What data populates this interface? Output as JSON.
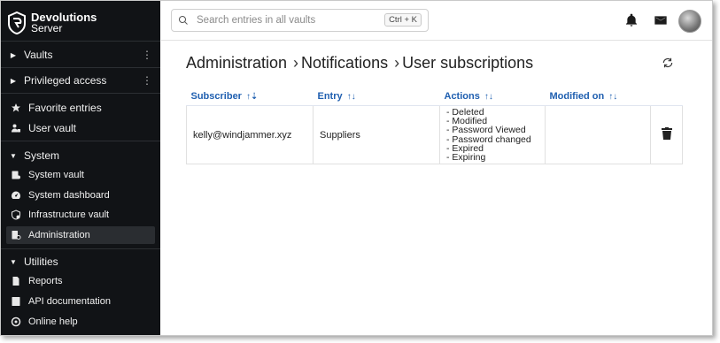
{
  "brand": {
    "name": "Devolutions",
    "product": "Server"
  },
  "sidebar": {
    "sections": [
      {
        "label": "Vaults"
      },
      {
        "label": "Privileged access"
      }
    ],
    "quick": [
      {
        "label": "Favorite entries",
        "icon": "star-icon"
      },
      {
        "label": "User vault",
        "icon": "user-vault-icon"
      }
    ],
    "system": {
      "label": "System",
      "items": [
        {
          "label": "System vault",
          "icon": "system-vault-icon"
        },
        {
          "label": "System dashboard",
          "icon": "dashboard-icon"
        },
        {
          "label": "Infrastructure vault",
          "icon": "infrastructure-vault-icon"
        },
        {
          "label": "Administration",
          "icon": "administration-icon"
        }
      ]
    },
    "utilities": {
      "label": "Utilities",
      "items": [
        {
          "label": "Reports",
          "icon": "reports-icon"
        },
        {
          "label": "API documentation",
          "icon": "api-documentation-icon"
        },
        {
          "label": "Online help",
          "icon": "help-icon"
        }
      ]
    }
  },
  "search": {
    "placeholder": "Search entries in all vaults",
    "shortcut": "Ctrl + K"
  },
  "breadcrumb": [
    "Administration",
    "Notifications",
    "User subscriptions"
  ],
  "table": {
    "columns": [
      {
        "label": "Subscriber",
        "sort": "↑⇣"
      },
      {
        "label": "Entry",
        "sort": "↑↓"
      },
      {
        "label": "Actions",
        "sort": "↑↓"
      },
      {
        "label": "Modified on",
        "sort": "↑↓"
      }
    ],
    "rows": [
      {
        "subscriber": "kelly@windjammer.xyz",
        "entry": "Suppliers",
        "actions": [
          "- Deleted",
          "- Modified",
          "- Password Viewed",
          "- Password changed",
          "- Expired",
          "- Expiring"
        ],
        "modified_on": ""
      }
    ]
  }
}
